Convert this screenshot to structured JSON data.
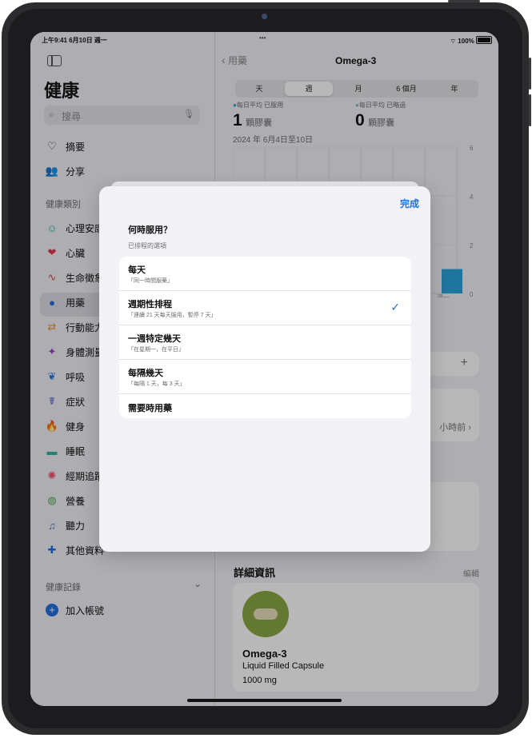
{
  "status": {
    "time": "上午9:41  6月10日 週一",
    "dots": "•••",
    "battery": "100%"
  },
  "sidebar": {
    "title": "健康",
    "search_placeholder": "搜尋",
    "summary": "摘要",
    "sharing": "分享",
    "categories_header": "健康類別",
    "items": [
      {
        "label": "心理安康",
        "icon": "brain-icon",
        "color": "#25b2a8"
      },
      {
        "label": "心臟",
        "icon": "heart-icon",
        "color": "#e8344e"
      },
      {
        "label": "生命徵象",
        "icon": "vitals-icon",
        "color": "#d84a4a"
      },
      {
        "label": "用藥",
        "icon": "pills-icon",
        "color": "#1f6fe0"
      },
      {
        "label": "行動能力",
        "icon": "mobility-icon",
        "color": "#f2902b"
      },
      {
        "label": "身體測量",
        "icon": "body-icon",
        "color": "#a13fc8"
      },
      {
        "label": "呼吸",
        "icon": "lungs-icon",
        "color": "#2f7be0"
      },
      {
        "label": "症狀",
        "icon": "symptoms-icon",
        "color": "#4f5cc8"
      },
      {
        "label": "健身",
        "icon": "fire-icon",
        "color": "#f2542b"
      },
      {
        "label": "睡眠",
        "icon": "bed-icon",
        "color": "#2bb2a0"
      },
      {
        "label": "經期追蹤",
        "icon": "cycle-icon",
        "color": "#f24e6a"
      },
      {
        "label": "營養",
        "icon": "apple-icon",
        "color": "#4caf50"
      },
      {
        "label": "聽力",
        "icon": "ear-icon",
        "color": "#3f7be0"
      },
      {
        "label": "其他資料",
        "icon": "plus-icon",
        "color": "#1f6fe0"
      }
    ],
    "records_header": "健康記錄",
    "add_account": "加入帳號"
  },
  "detail": {
    "back": "用藥",
    "title": "Omega-3",
    "segments": [
      "天",
      "週",
      "月",
      "6 個月",
      "年"
    ],
    "selected_segment": "週",
    "stat1_label": "每日平均 已服用",
    "stat1_value": "1",
    "stat1_unit": "顆膠囊",
    "stat2_label": "每日平均 已略過",
    "stat2_value": "0",
    "stat2_unit": "顆膠囊",
    "date_range": "2024 年 6月4日至10日",
    "hours_ago": "小時前",
    "details_header": "詳細資訊",
    "edit": "編輯",
    "med_name": "Omega-3",
    "med_form": "Liquid Filled Capsule",
    "med_dose": "1000 mg"
  },
  "chart_data": {
    "type": "bar",
    "categories": [
      "週一"
    ],
    "values": [
      1
    ],
    "ylim": [
      0,
      6
    ],
    "yticks": [
      "6",
      "4",
      "2",
      "0"
    ],
    "color": "#2aa3dc"
  },
  "modal": {
    "done": "完成",
    "question": "何時服用？",
    "hint": "已排程的選項",
    "options": [
      {
        "title": "每天",
        "sub": "「同一時間服藥」"
      },
      {
        "title": "週期性排程",
        "sub": "「連續 21 天每天服用，暫停 7 天」",
        "checked": true
      },
      {
        "title": "一週特定幾天",
        "sub": "「在星期一，在平日」"
      },
      {
        "title": "每隔幾天",
        "sub": "「每隔 1 天，每 3 天」"
      },
      {
        "title": "需要時用藥",
        "sub": ""
      }
    ]
  }
}
